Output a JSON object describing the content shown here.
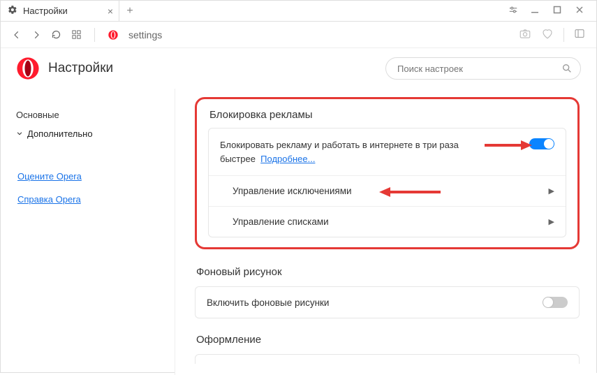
{
  "tab": {
    "title": "Настройки"
  },
  "address": {
    "text": "settings"
  },
  "header": {
    "title": "Настройки",
    "search_placeholder": "Поиск настроек"
  },
  "sidebar": {
    "items": [
      {
        "label": "Основные"
      },
      {
        "label": "Дополнительно"
      }
    ],
    "links": [
      {
        "label": "Оцените Opera"
      },
      {
        "label": "Справка Opera"
      }
    ]
  },
  "adblock": {
    "title": "Блокировка рекламы",
    "desc": "Блокировать рекламу и работать в интернете в три раза быстрее",
    "more": "Подробнее...",
    "exceptions": "Управление исключениями",
    "lists": "Управление списками"
  },
  "wallpaper": {
    "title": "Фоновый рисунок",
    "enable": "Включить фоновые рисунки"
  },
  "appearance": {
    "title": "Оформление"
  }
}
